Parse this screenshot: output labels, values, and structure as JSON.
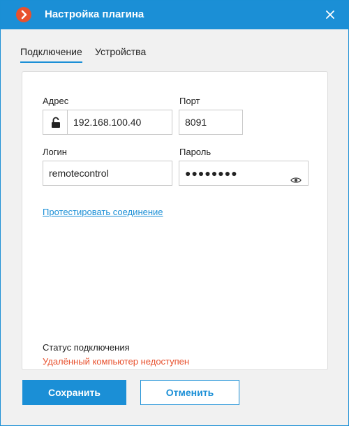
{
  "window": {
    "title": "Настройка плагина",
    "icons": {
      "logo": "app-logo-icon",
      "close": "close-icon"
    },
    "colors": {
      "accent": "#1b8fd6",
      "error": "#e8512e"
    }
  },
  "tabs": [
    {
      "label": "Подключение",
      "active": true
    },
    {
      "label": "Устройства",
      "active": false
    }
  ],
  "form": {
    "address_label": "Адрес",
    "address_value": "192.168.100.40",
    "port_label": "Порт",
    "port_value": "8091",
    "login_label": "Логин",
    "login_value": "remotecontrol",
    "password_label": "Пароль",
    "password_masked": "●●●●●●●●",
    "icons": {
      "lock": "unlock-icon",
      "reveal": "eye-icon"
    }
  },
  "test_link": "Протестировать соединение",
  "status": {
    "label": "Статус подключения",
    "value": "Удалённый компьютер недоступен"
  },
  "buttons": {
    "save": "Сохранить",
    "cancel": "Отменить"
  }
}
